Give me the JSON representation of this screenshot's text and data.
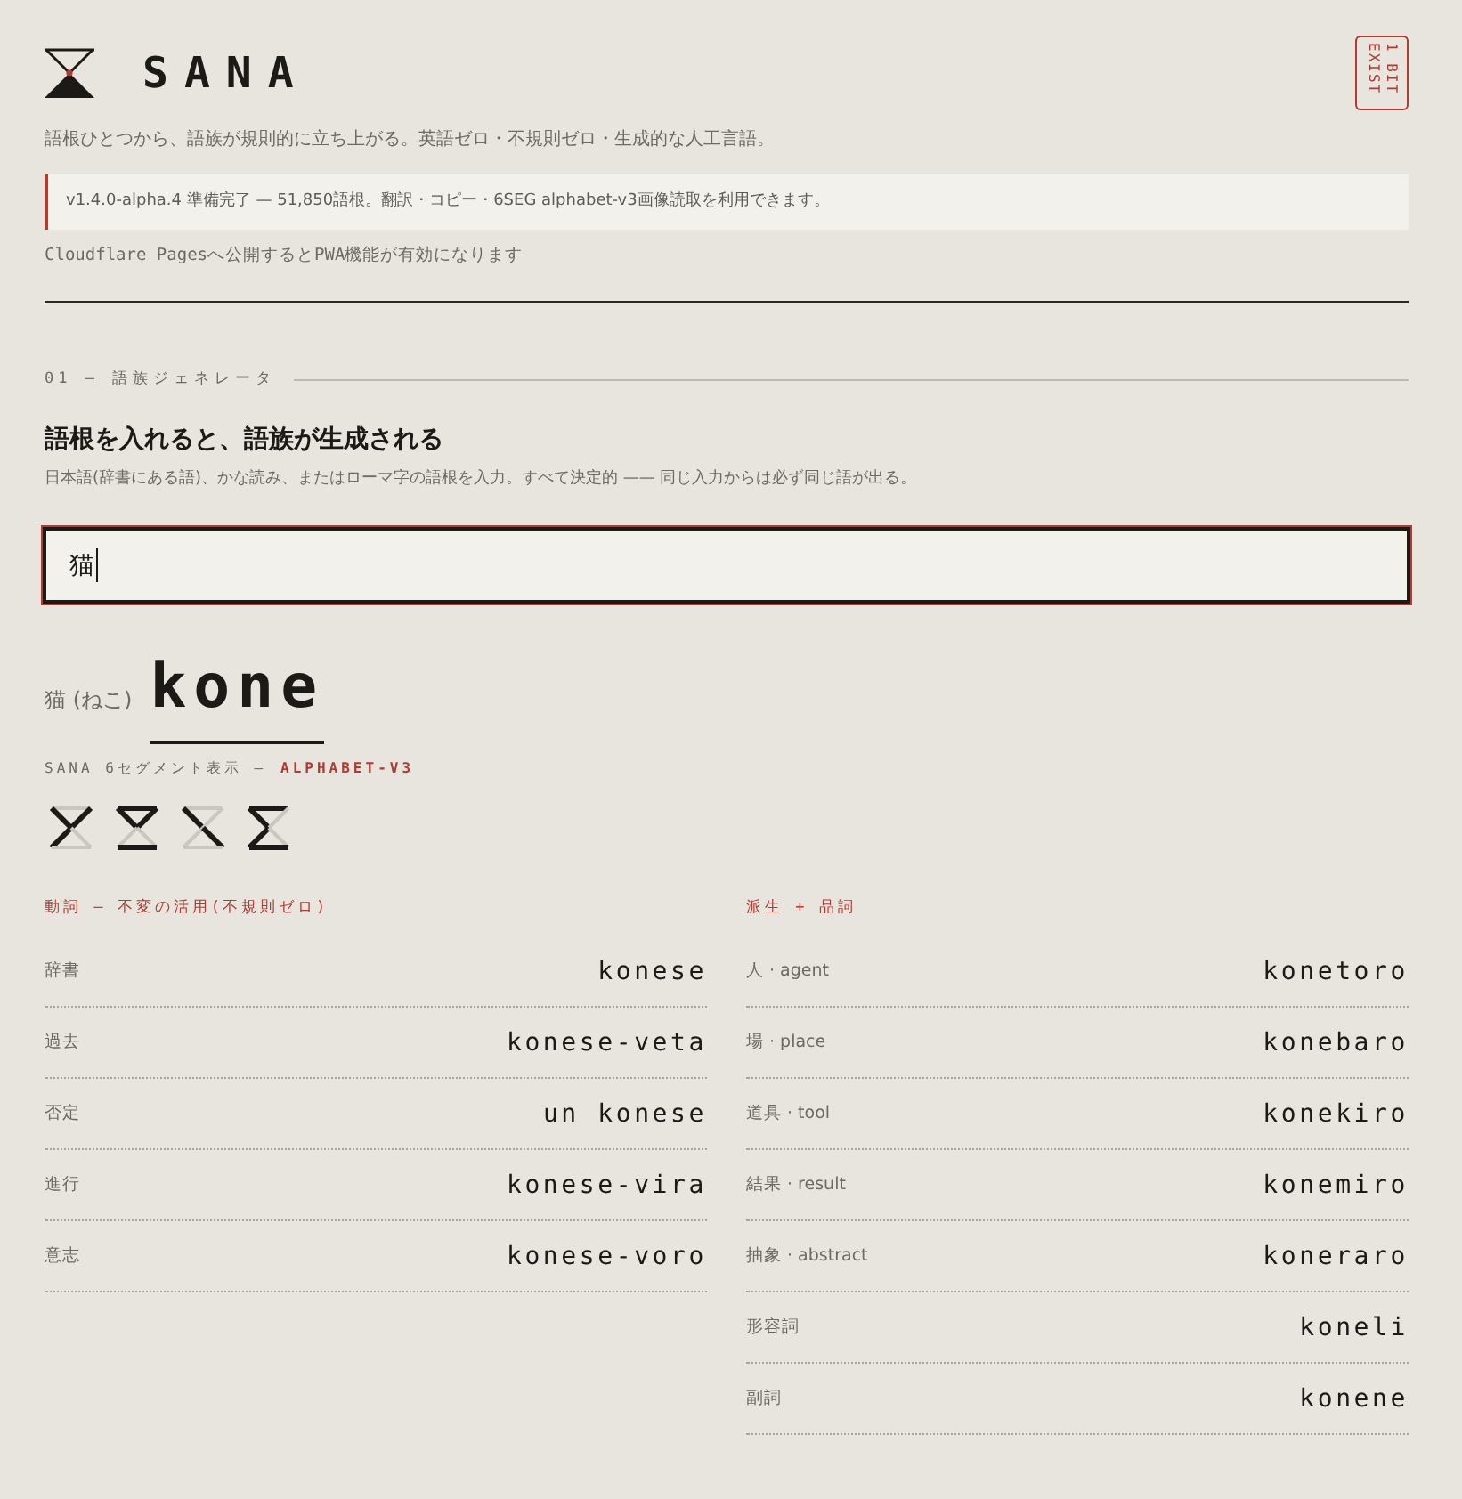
{
  "header": {
    "title": "SANA",
    "badge": "1 BIT EXIST",
    "tagline": "語根ひとつから、語族が規則的に立ち上がる。英語ゼロ・不規則ゼロ・生成的な人工言語。"
  },
  "notice": {
    "text": "v1.4.0-alpha.4 準備完了 — 51,850語根。翻訳・コピー・6SEG alphabet-v3画像読取を利用できます。"
  },
  "deploy_note": "Cloudflare Pagesへ公開するとPWA機能が有効になります",
  "generator": {
    "section_label": "01 — 語族ジェネレータ",
    "heading": "語根を入れると、語族が生成される",
    "description": "日本語(辞書にある語)、かな読み、またはローマ字の語根を入力。すべて決定的 —— 同じ入力からは必ず同じ語が出る。",
    "input": {
      "value": "猫",
      "focused": true
    }
  },
  "result": {
    "source": "猫 (ねこ)",
    "word": "kone"
  },
  "segment_display": {
    "label": "SANA 6セグメント表示 —",
    "alphabet": "ALPHABET-V3",
    "glyphs": [
      {
        "top": false,
        "upper_left": true,
        "upper_right": true,
        "lower_left": true,
        "lower_right": false,
        "bottom": false
      },
      {
        "top": true,
        "upper_left": true,
        "upper_right": true,
        "lower_left": false,
        "lower_right": false,
        "bottom": true
      },
      {
        "top": false,
        "upper_left": true,
        "upper_right": false,
        "lower_left": false,
        "lower_right": true,
        "bottom": false
      },
      {
        "top": true,
        "upper_left": true,
        "upper_right": false,
        "lower_left": true,
        "lower_right": false,
        "bottom": true
      }
    ]
  },
  "conjugation": {
    "title": "動詞 — 不変の活用(不規則ゼロ)",
    "rows": [
      {
        "label": "辞書",
        "value": "konese"
      },
      {
        "label": "過去",
        "value": "konese-veta"
      },
      {
        "label": "否定",
        "value": "un konese"
      },
      {
        "label": "進行",
        "value": "konese-vira"
      },
      {
        "label": "意志",
        "value": "konese-voro"
      }
    ]
  },
  "derivation": {
    "title": "派生 + 品詞",
    "rows": [
      {
        "label": "人 · agent",
        "value": "konetoro"
      },
      {
        "label": "場 · place",
        "value": "konebaro"
      },
      {
        "label": "道具 · tool",
        "value": "konekiro"
      },
      {
        "label": "結果 · result",
        "value": "konemiro"
      },
      {
        "label": "抽象 · abstract",
        "value": "koneraro"
      },
      {
        "label": "形容詞",
        "value": "koneli"
      },
      {
        "label": "副詞",
        "value": "konene"
      }
    ]
  }
}
